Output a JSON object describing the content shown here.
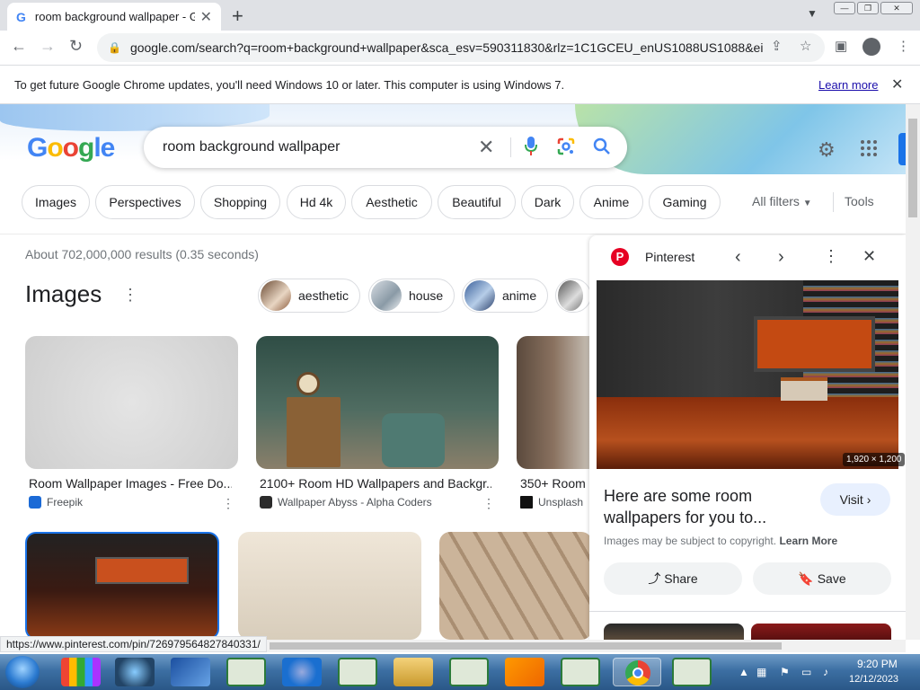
{
  "browser": {
    "tab_title": "room background wallpaper - Go",
    "tab_favicon": "G",
    "url": "google.com/search?q=room+background+wallpaper&sca_esv=590311830&rlz=1C1GCEU_enUS1088US1088&ei...",
    "status_url": "https://www.pinterest.com/pin/726979564827840331/"
  },
  "infobar": {
    "message": "To get future Google Chrome updates, you'll need Windows 10 or later. This computer is using Windows 7.",
    "learn_more": "Learn more"
  },
  "search": {
    "query": "room background wallpaper"
  },
  "chips": [
    "Images",
    "Perspectives",
    "Shopping",
    "Hd 4k",
    "Aesthetic",
    "Beautiful",
    "Dark",
    "Anime",
    "Gaming"
  ],
  "filters": {
    "all_filters": "All filters",
    "tools": "Tools"
  },
  "results": {
    "stats": "About 702,000,000 results (0.35 seconds)",
    "images_heading": "Images",
    "refinements": [
      "aesthetic",
      "house",
      "anime"
    ],
    "cards": [
      {
        "title": "Room Wallpaper Images - Free Do...",
        "source": "Freepik"
      },
      {
        "title": "2100+ Room HD Wallpapers and Backgr...",
        "source": "Wallpaper Abyss - Alpha Coders"
      },
      {
        "title": "350+ Room",
        "source": "Unsplash"
      }
    ]
  },
  "panel": {
    "source": "Pinterest",
    "dimensions": "1,920 × 1,200",
    "title": "Here are some room wallpapers for you to...",
    "visit": "Visit",
    "copyright": "Images may be subject to copyright.",
    "learn_more": "Learn More",
    "share": "Share",
    "save": "Save"
  },
  "taskbar": {
    "time": "9:20 PM",
    "date": "12/12/2023"
  },
  "colors": {
    "accent": "#1a73e8",
    "pinterest": "#e60023",
    "chip_border": "#dadce0"
  }
}
